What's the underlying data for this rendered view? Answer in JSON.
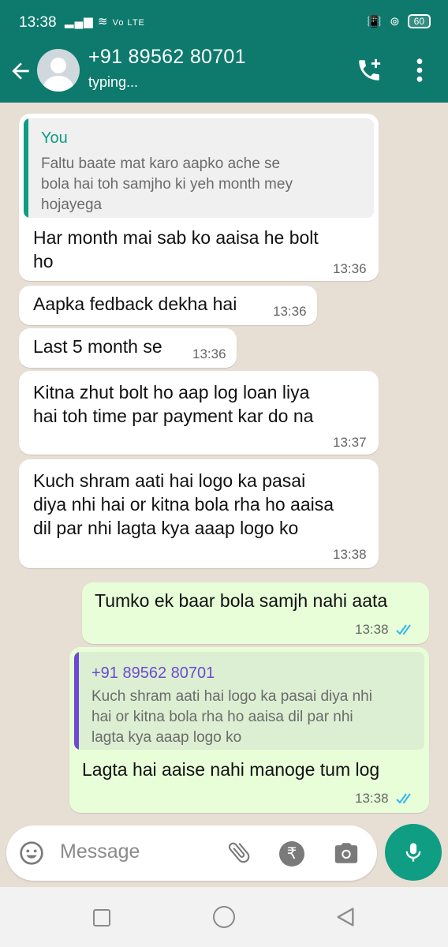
{
  "status_bar": {
    "time": "13:38",
    "network": "Vo LTE",
    "battery": "60"
  },
  "header": {
    "contact_name": "+91 89562 80701",
    "presence": "typing..."
  },
  "messages": [
    {
      "direction": "in",
      "quote_author": "You",
      "quote_lines": [
        "Faltu baate mat karo aapko ache se",
        "bola hai toh samjho ki yeh month mey",
        "hojayega"
      ],
      "lines": [
        "Har month mai sab ko aaisa he bolt",
        "ho"
      ],
      "time": "13:36"
    },
    {
      "direction": "in",
      "lines": [
        "Aapka fedback dekha hai"
      ],
      "time": "13:36"
    },
    {
      "direction": "in",
      "lines": [
        "Last 5 month se"
      ],
      "time": "13:36"
    },
    {
      "direction": "in",
      "lines": [
        "Kitna zhut bolt ho aap log loan liya",
        "hai toh time par payment kar do na"
      ],
      "time": "13:37"
    },
    {
      "direction": "in",
      "lines": [
        "Kuch shram aati hai logo ka pasai",
        "diya nhi hai or kitna bola rha ho aaisa",
        "dil par nhi lagta kya aaap logo ko"
      ],
      "time": "13:38"
    },
    {
      "direction": "out",
      "lines": [
        "Tumko ek baar bola samjh nahi aata"
      ],
      "time": "13:38"
    },
    {
      "direction": "out",
      "quote_author": "+91 89562 80701",
      "quote_lines": [
        "Kuch shram aati hai logo ka pasai diya nhi",
        "hai or kitna bola rha ho aaisa dil par nhi",
        "lagta kya aaap logo ko"
      ],
      "lines": [
        "Lagta hai aaise nahi manoge tum log"
      ],
      "time": "13:38"
    }
  ],
  "composer": {
    "placeholder": "Message"
  },
  "colors": {
    "header": "#0d7a6d",
    "accent": "#0f9d83",
    "outgoing_bubble": "#e7fed8",
    "tick_blue": "#34b7f1",
    "quote_in": "#0f9d83",
    "quote_out": "#6c4bd0"
  }
}
